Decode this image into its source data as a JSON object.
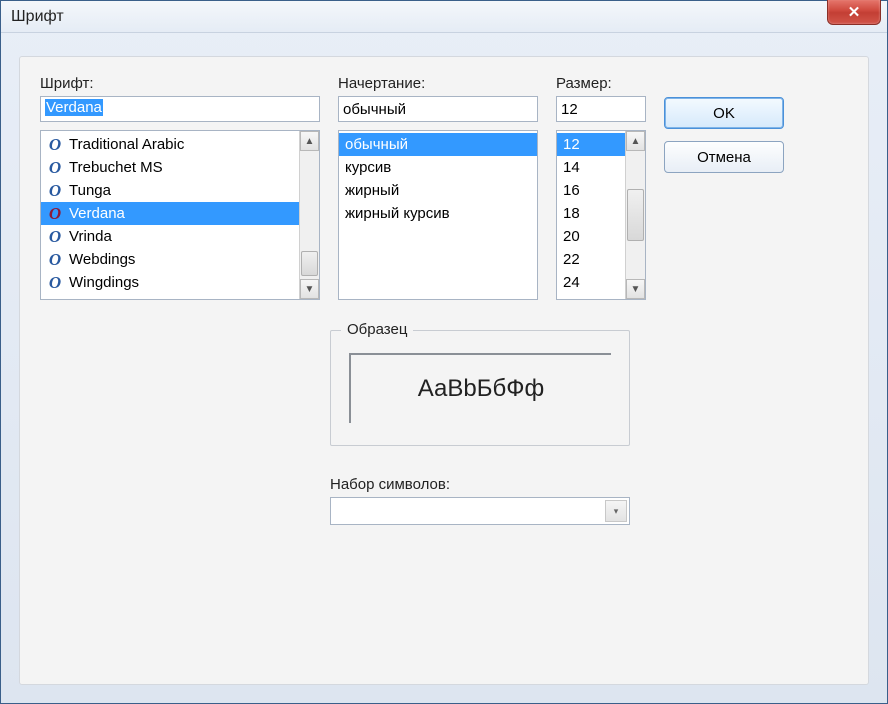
{
  "window": {
    "title": "Шрифт"
  },
  "font": {
    "label": "Шрифт:",
    "value": "Verdana",
    "items": [
      {
        "name": "Traditional Arabic",
        "selected": false
      },
      {
        "name": "Trebuchet MS",
        "selected": false
      },
      {
        "name": "Tunga",
        "selected": false
      },
      {
        "name": "Verdana",
        "selected": true
      },
      {
        "name": "Vrinda",
        "selected": false
      },
      {
        "name": "Webdings",
        "selected": false
      },
      {
        "name": "Wingdings",
        "selected": false
      }
    ]
  },
  "style": {
    "label": "Начертание:",
    "value": "обычный",
    "items": [
      {
        "name": "обычный",
        "selected": true
      },
      {
        "name": "курсив",
        "selected": false
      },
      {
        "name": "жирный",
        "selected": false
      },
      {
        "name": "жирный курсив",
        "selected": false
      }
    ]
  },
  "size": {
    "label": "Размер:",
    "value": "12",
    "items": [
      {
        "name": "12",
        "selected": true
      },
      {
        "name": "14",
        "selected": false
      },
      {
        "name": "16",
        "selected": false
      },
      {
        "name": "18",
        "selected": false
      },
      {
        "name": "20",
        "selected": false
      },
      {
        "name": "22",
        "selected": false
      },
      {
        "name": "24",
        "selected": false
      }
    ]
  },
  "buttons": {
    "ok": "OK",
    "cancel": "Отмена"
  },
  "sample": {
    "label": "Образец",
    "text": "АаВbБбФф"
  },
  "charset": {
    "label": "Набор символов:",
    "value": ""
  },
  "icons": {
    "font_glyph": "O",
    "close_glyph": "✕",
    "up": "▲",
    "down": "▼",
    "combo_down": "▾"
  }
}
